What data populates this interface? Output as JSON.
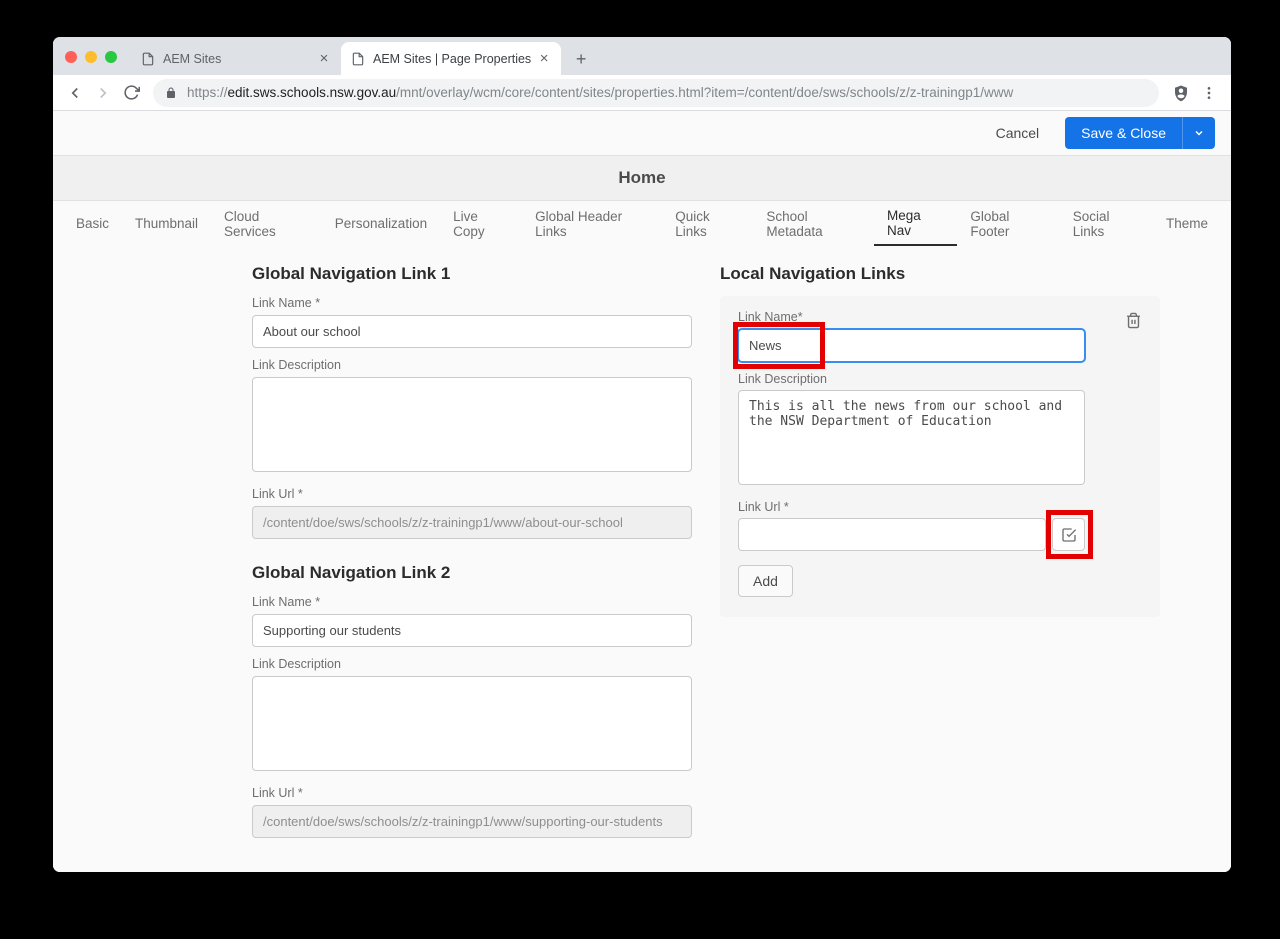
{
  "browser": {
    "tabs": [
      {
        "title": "AEM Sites",
        "active": false
      },
      {
        "title": "AEM Sites | Page Properties",
        "active": true
      }
    ],
    "url_prefix": "https://",
    "url_host": "edit.sws.schools.nsw.gov.au",
    "url_path": "/mnt/overlay/wcm/core/content/sites/properties.html?item=/content/doe/sws/schools/z/z-trainingp1/www"
  },
  "actions": {
    "cancel": "Cancel",
    "save_close": "Save & Close"
  },
  "page_title": "Home",
  "tabs": [
    "Basic",
    "Thumbnail",
    "Cloud Services",
    "Personalization",
    "Live Copy",
    "Global Header Links",
    "Quick Links",
    "School Metadata",
    "Mega Nav",
    "Global Footer",
    "Social Links",
    "Theme"
  ],
  "active_tab": "Mega Nav",
  "global_links": [
    {
      "heading": "Global Navigation Link 1",
      "name_label": "Link Name *",
      "name_value": "About our school",
      "desc_label": "Link Description",
      "desc_value": "",
      "url_label": "Link Url *",
      "url_value": "/content/doe/sws/schools/z/z-trainingp1/www/about-our-school"
    },
    {
      "heading": "Global Navigation Link 2",
      "name_label": "Link Name *",
      "name_value": "Supporting our students",
      "desc_label": "Link Description",
      "desc_value": "",
      "url_label": "Link Url *",
      "url_value": "/content/doe/sws/schools/z/z-trainingp1/www/supporting-our-students"
    }
  ],
  "local": {
    "heading": "Local Navigation Links",
    "name_label": "Link Name*",
    "name_value": "News",
    "desc_label": "Link Description",
    "desc_value": "This is all the news from our school and the NSW Department of Education",
    "url_label": "Link Url *",
    "url_value": "",
    "add_label": "Add"
  }
}
